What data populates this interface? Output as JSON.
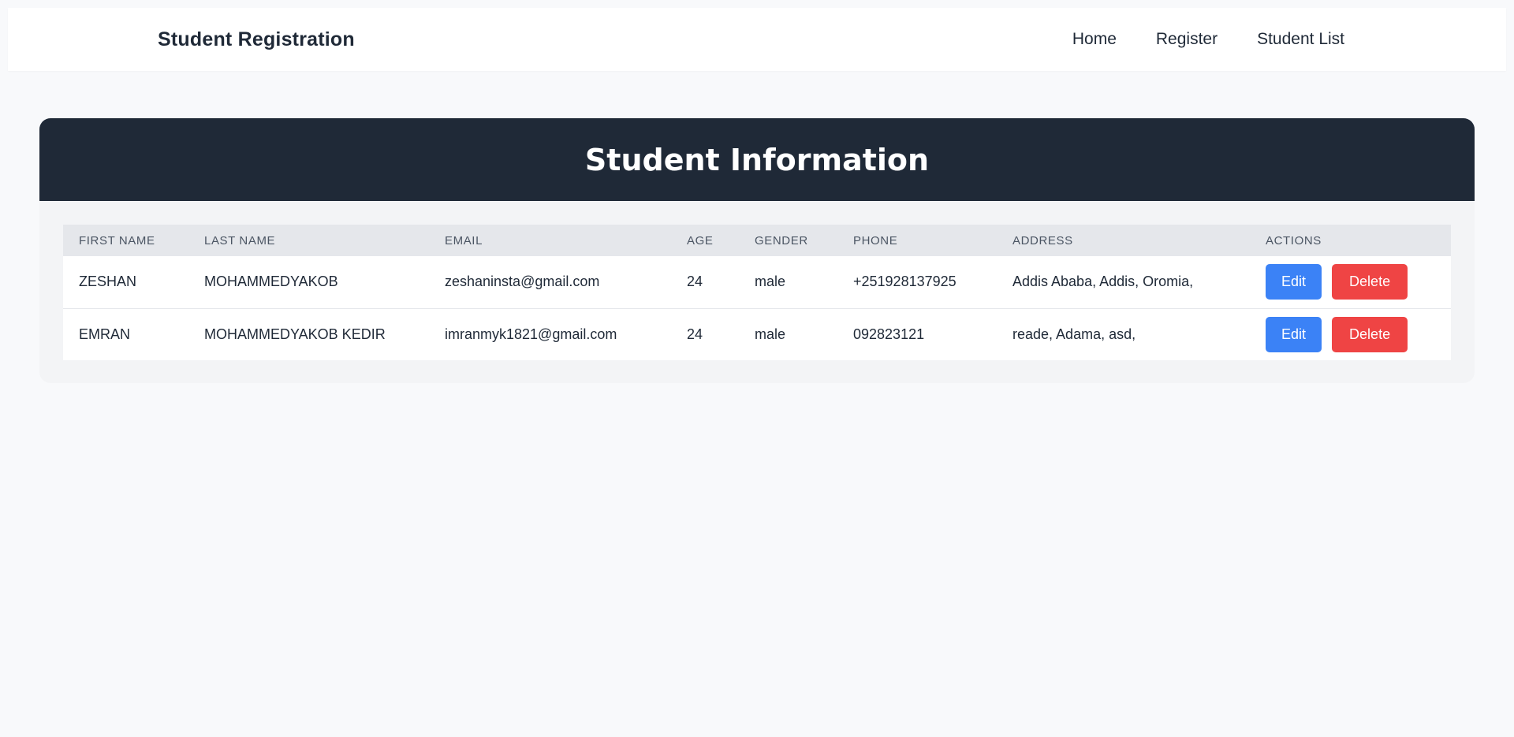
{
  "header": {
    "brand": "Student Registration",
    "nav": [
      {
        "label": "Home"
      },
      {
        "label": "Register"
      },
      {
        "label": "Student List"
      }
    ]
  },
  "main": {
    "title": "Student Information",
    "columns": [
      "FIRST NAME",
      "LAST NAME",
      "EMAIL",
      "AGE",
      "GENDER",
      "PHONE",
      "ADDRESS",
      "ACTIONS"
    ],
    "rows": [
      {
        "first_name": "ZESHAN",
        "last_name": "MOHAMMEDYAKOB",
        "email": "zeshaninsta@gmail.com",
        "age": "24",
        "gender": "male",
        "phone": "+251928137925",
        "address": "Addis Ababa, Addis, Oromia,",
        "edit_label": "Edit",
        "delete_label": "Delete"
      },
      {
        "first_name": "EMRAN",
        "last_name": "MOHAMMEDYAKOB KEDIR",
        "email": "imranmyk1821@gmail.com",
        "age": "24",
        "gender": "male",
        "phone": "092823121",
        "address": "reade, Adama, asd,",
        "edit_label": "Edit",
        "delete_label": "Delete"
      }
    ]
  },
  "colors": {
    "header_bg": "#1f2937",
    "edit_button": "#3b82f6",
    "delete_button": "#ef4444",
    "page_bg": "#f8f9fb"
  }
}
